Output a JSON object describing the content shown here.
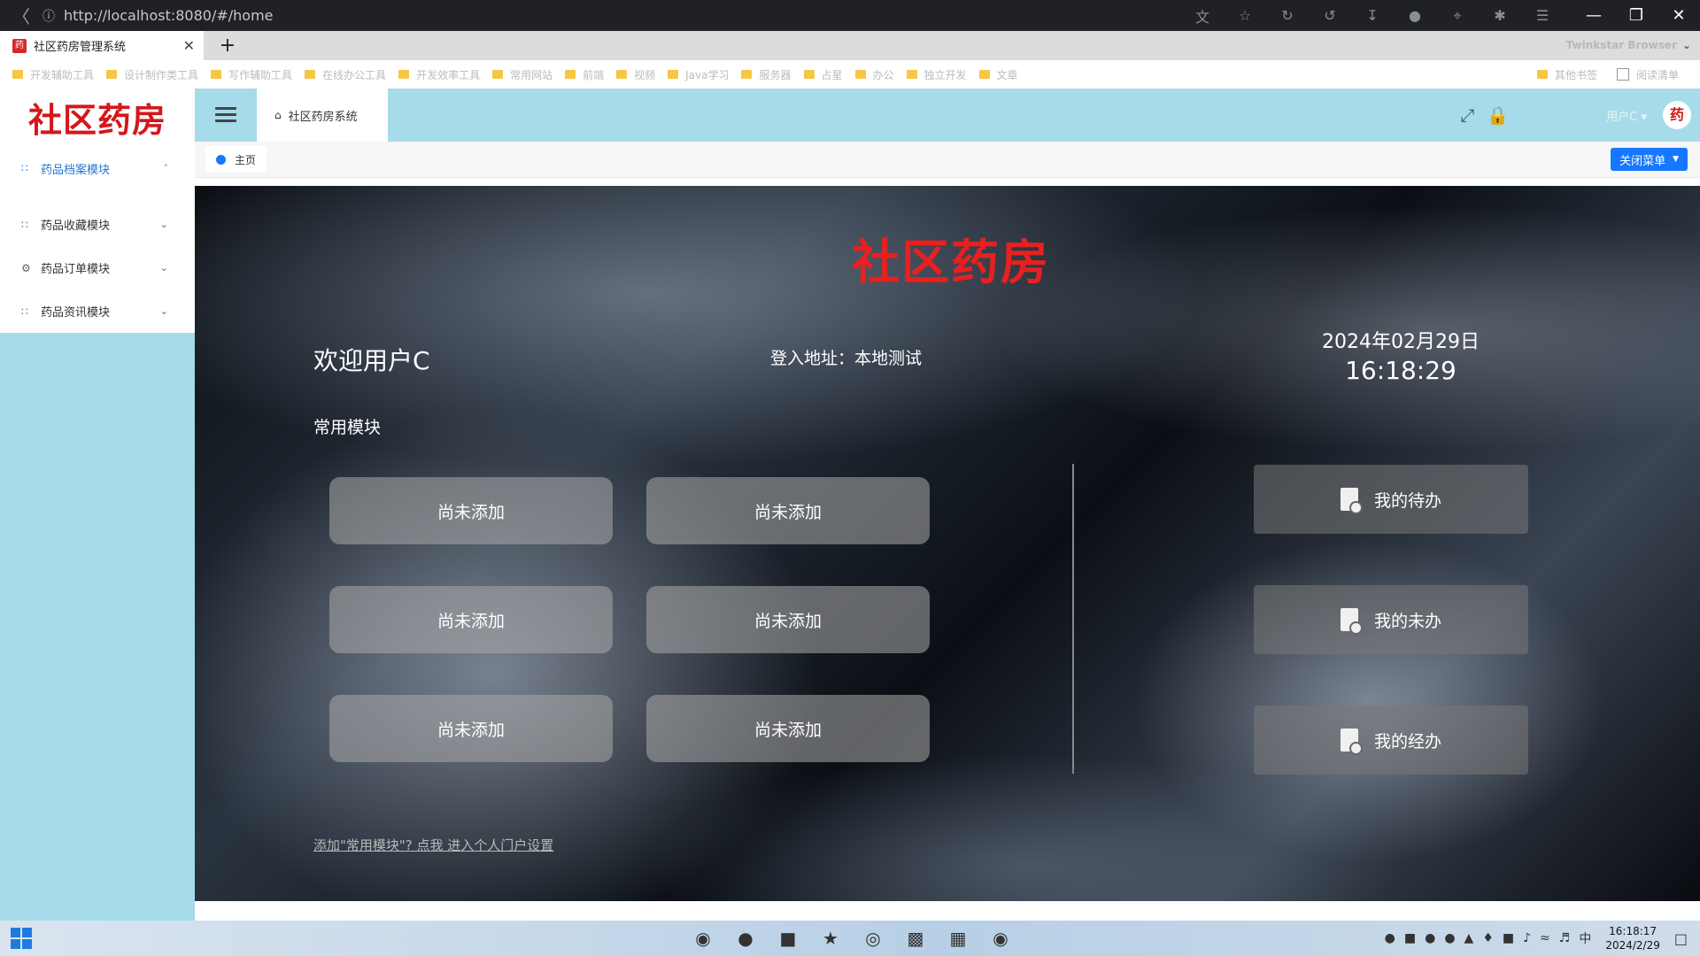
{
  "browser": {
    "url": "http://localhost:8080/#/home",
    "tab_title": "社区药房管理系统",
    "favicon_text": "药",
    "new_tab": "+",
    "brand": "Twinkstar Browser",
    "bookmarks": [
      "开发辅助工具",
      "设计制作类工具",
      "写作辅助工具",
      "在线办公工具",
      "开发效率工具",
      "常用网站",
      "前端",
      "视频",
      "Java学习",
      "服务器",
      "占星",
      "办公",
      "独立开发",
      "文章"
    ],
    "bookmarks_right": [
      "其他书签",
      "阅读清单"
    ]
  },
  "sidebar": {
    "logo": "社区药房",
    "items": [
      {
        "label": "药品档案模块"
      },
      {
        "label": "药品收藏模块"
      },
      {
        "label": "药品订单模块"
      },
      {
        "label": "药品资讯模块"
      }
    ]
  },
  "header": {
    "tab_label": "社区药房系统",
    "user_menu": "用户C ▾",
    "avatar_text": "药"
  },
  "tags": {
    "home": "主页",
    "close_menu": "关闭菜单"
  },
  "dashboard": {
    "logo": "社区药房",
    "welcome": "欢迎用户C",
    "login_address": "登入地址：本地测试",
    "date": "2024年02月29日",
    "time": "16:18:29",
    "common_title": "常用模块",
    "quick_modules": [
      "尚未添加",
      "尚未添加",
      "尚未添加",
      "尚未添加",
      "尚未添加",
      "尚未添加"
    ],
    "tasks": [
      "我的待办",
      "我的未办",
      "我的经办"
    ],
    "portal_link": "添加\"常用模块\"? 点我 进入个人门户设置"
  },
  "taskbar": {
    "clock_time": "16:18:17",
    "clock_date": "2024/2/29"
  },
  "colors": {
    "accent": "#1677ff",
    "sidebar_bg": "#a6dbe9",
    "logo_red": "#d4171b"
  }
}
